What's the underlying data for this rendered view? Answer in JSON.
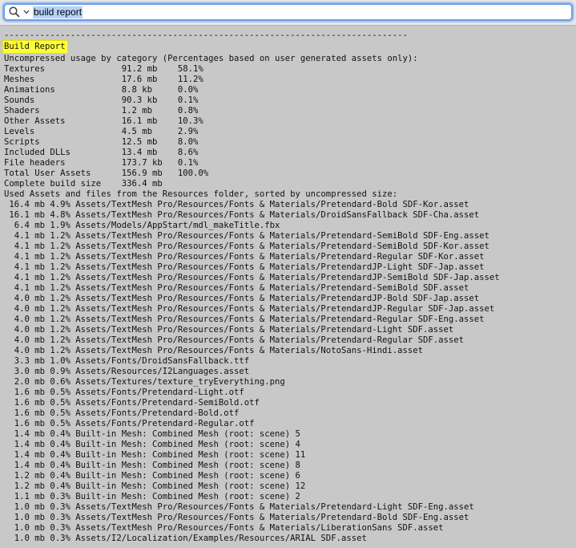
{
  "search": {
    "query": "build report"
  },
  "report": {
    "separator": "-------------------------------------------------------------------------------",
    "title": "Build Report",
    "usage_header": "Uncompressed usage by category (Percentages based on user generated assets only):",
    "categories": [
      {
        "name": "Textures",
        "size": "91.2 mb",
        "percent": "58.1%"
      },
      {
        "name": "Meshes",
        "size": "17.6 mb",
        "percent": "11.2%"
      },
      {
        "name": "Animations",
        "size": "8.8 kb",
        "percent": "0.0%"
      },
      {
        "name": "Sounds",
        "size": "90.3 kb",
        "percent": "0.1%"
      },
      {
        "name": "Shaders",
        "size": "1.2 mb",
        "percent": "0.8%"
      },
      {
        "name": "Other Assets",
        "size": "16.1 mb",
        "percent": "10.3%"
      },
      {
        "name": "Levels",
        "size": "4.5 mb",
        "percent": "2.9%"
      },
      {
        "name": "Scripts",
        "size": "12.5 mb",
        "percent": "8.0%"
      },
      {
        "name": "Included DLLs",
        "size": "13.4 mb",
        "percent": "8.6%"
      },
      {
        "name": "File headers",
        "size": "173.7 kb",
        "percent": "0.1%"
      },
      {
        "name": "Total User Assets",
        "size": "156.9 mb",
        "percent": "100.0%"
      },
      {
        "name": "Complete build size",
        "size": "336.4 mb",
        "percent": ""
      }
    ],
    "assets_header": "Used Assets and files from the Resources folder, sorted by uncompressed size:",
    "assets": [
      {
        "size": "16.4 mb",
        "percent": "4.9%",
        "path": "Assets/TextMesh Pro/Resources/Fonts & Materials/Pretendard-Bold SDF-Kor.asset"
      },
      {
        "size": "16.1 mb",
        "percent": "4.8%",
        "path": "Assets/TextMesh Pro/Resources/Fonts & Materials/DroidSansFallback SDF-Cha.asset"
      },
      {
        "size": "6.4 mb",
        "percent": "1.9%",
        "path": "Assets/Models/AppStart/mdl_makeTitle.fbx"
      },
      {
        "size": "4.1 mb",
        "percent": "1.2%",
        "path": "Assets/TextMesh Pro/Resources/Fonts & Materials/Pretendard-SemiBold SDF-Eng.asset"
      },
      {
        "size": "4.1 mb",
        "percent": "1.2%",
        "path": "Assets/TextMesh Pro/Resources/Fonts & Materials/Pretendard-SemiBold SDF-Kor.asset"
      },
      {
        "size": "4.1 mb",
        "percent": "1.2%",
        "path": "Assets/TextMesh Pro/Resources/Fonts & Materials/Pretendard-Regular SDF-Kor.asset"
      },
      {
        "size": "4.1 mb",
        "percent": "1.2%",
        "path": "Assets/TextMesh Pro/Resources/Fonts & Materials/PretendardJP-Light SDF-Jap.asset"
      },
      {
        "size": "4.1 mb",
        "percent": "1.2%",
        "path": "Assets/TextMesh Pro/Resources/Fonts & Materials/PretendardJP-SemiBold SDF-Jap.asset"
      },
      {
        "size": "4.1 mb",
        "percent": "1.2%",
        "path": "Assets/TextMesh Pro/Resources/Fonts & Materials/Pretendard-SemiBold SDF.asset"
      },
      {
        "size": "4.0 mb",
        "percent": "1.2%",
        "path": "Assets/TextMesh Pro/Resources/Fonts & Materials/PretendardJP-Bold SDF-Jap.asset"
      },
      {
        "size": "4.0 mb",
        "percent": "1.2%",
        "path": "Assets/TextMesh Pro/Resources/Fonts & Materials/PretendardJP-Regular SDF-Jap.asset"
      },
      {
        "size": "4.0 mb",
        "percent": "1.2%",
        "path": "Assets/TextMesh Pro/Resources/Fonts & Materials/Pretendard-Regular SDF-Eng.asset"
      },
      {
        "size": "4.0 mb",
        "percent": "1.2%",
        "path": "Assets/TextMesh Pro/Resources/Fonts & Materials/Pretendard-Light SDF.asset"
      },
      {
        "size": "4.0 mb",
        "percent": "1.2%",
        "path": "Assets/TextMesh Pro/Resources/Fonts & Materials/Pretendard-Regular SDF.asset"
      },
      {
        "size": "4.0 mb",
        "percent": "1.2%",
        "path": "Assets/TextMesh Pro/Resources/Fonts & Materials/NotoSans-Hindi.asset"
      },
      {
        "size": "3.3 mb",
        "percent": "1.0%",
        "path": "Assets/Fonts/DroidSansFallback.ttf"
      },
      {
        "size": "3.0 mb",
        "percent": "0.9%",
        "path": "Assets/Resources/I2Languages.asset"
      },
      {
        "size": "2.0 mb",
        "percent": "0.6%",
        "path": "Assets/Textures/texture_tryEverything.png"
      },
      {
        "size": "1.6 mb",
        "percent": "0.5%",
        "path": "Assets/Fonts/Pretendard-Light.otf"
      },
      {
        "size": "1.6 mb",
        "percent": "0.5%",
        "path": "Assets/Fonts/Pretendard-SemiBold.otf"
      },
      {
        "size": "1.6 mb",
        "percent": "0.5%",
        "path": "Assets/Fonts/Pretendard-Bold.otf"
      },
      {
        "size": "1.6 mb",
        "percent": "0.5%",
        "path": "Assets/Fonts/Pretendard-Regular.otf"
      },
      {
        "size": "1.4 mb",
        "percent": "0.4%",
        "path": "Built-in Mesh: Combined Mesh (root: scene) 5"
      },
      {
        "size": "1.4 mb",
        "percent": "0.4%",
        "path": "Built-in Mesh: Combined Mesh (root: scene) 4"
      },
      {
        "size": "1.4 mb",
        "percent": "0.4%",
        "path": "Built-in Mesh: Combined Mesh (root: scene) 11"
      },
      {
        "size": "1.4 mb",
        "percent": "0.4%",
        "path": "Built-in Mesh: Combined Mesh (root: scene) 8"
      },
      {
        "size": "1.2 mb",
        "percent": "0.4%",
        "path": "Built-in Mesh: Combined Mesh (root: scene) 6"
      },
      {
        "size": "1.2 mb",
        "percent": "0.4%",
        "path": "Built-in Mesh: Combined Mesh (root: scene) 12"
      },
      {
        "size": "1.1 mb",
        "percent": "0.3%",
        "path": "Built-in Mesh: Combined Mesh (root: scene) 2"
      },
      {
        "size": "1.0 mb",
        "percent": "0.3%",
        "path": "Assets/TextMesh Pro/Resources/Fonts & Materials/Pretendard-Light SDF-Eng.asset"
      },
      {
        "size": "1.0 mb",
        "percent": "0.3%",
        "path": "Assets/TextMesh Pro/Resources/Fonts & Materials/Pretendard-Bold SDF-Eng.asset"
      },
      {
        "size": "1.0 mb",
        "percent": "0.3%",
        "path": "Assets/TextMesh Pro/Resources/Fonts & Materials/LiberationSans SDF.asset"
      },
      {
        "size": "1.0 mb",
        "percent": "0.3%",
        "path": "Assets/I2/Localization/Examples/Resources/ARIAL SDF.asset"
      }
    ]
  },
  "colors": {
    "highlight": "#ffff38",
    "search_border": "#6f9fe2",
    "selection": "#b3d2fb",
    "background": "#c8c8c8"
  }
}
